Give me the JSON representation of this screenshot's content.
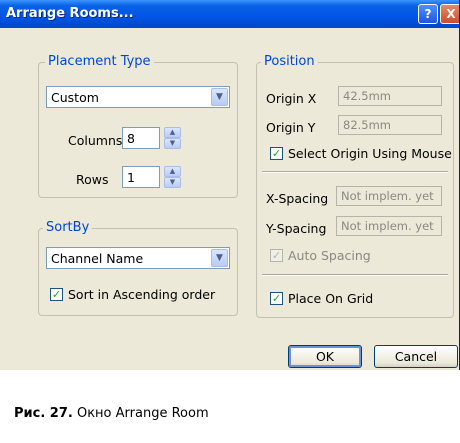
{
  "window": {
    "title": "Arrange Rooms...",
    "help_icon": "?",
    "close_icon": "X"
  },
  "placement": {
    "legend": "Placement Type",
    "type_value": "Custom",
    "columns_label": "Columns",
    "columns_value": "8",
    "rows_label": "Rows",
    "rows_value": "1"
  },
  "sortby": {
    "legend": "SortBy",
    "value": "Channel Name",
    "ascending_label": "Sort in Ascending order",
    "ascending_checked": true
  },
  "position": {
    "legend": "Position",
    "origin_x_label": "Origin X",
    "origin_x_value": "42.5mm",
    "origin_y_label": "Origin Y",
    "origin_y_value": "82.5mm",
    "select_origin_label": "Select Origin Using Mouse",
    "x_spacing_label": "X-Spacing",
    "x_spacing_value": "Not implem. yet",
    "y_spacing_label": "Y-Spacing",
    "y_spacing_value": "Not implem. yet",
    "auto_spacing_label": "Auto Spacing",
    "place_on_grid_label": "Place On Grid"
  },
  "buttons": {
    "ok": "OK",
    "cancel": "Cancel"
  },
  "caption": {
    "prefix": "Рис. 27.",
    "text": " Окно Arrange Room"
  },
  "colors": {
    "title_bar": "#0055e5",
    "dialog_bg": "#ece9d8",
    "legend_text": "#0046d5"
  }
}
